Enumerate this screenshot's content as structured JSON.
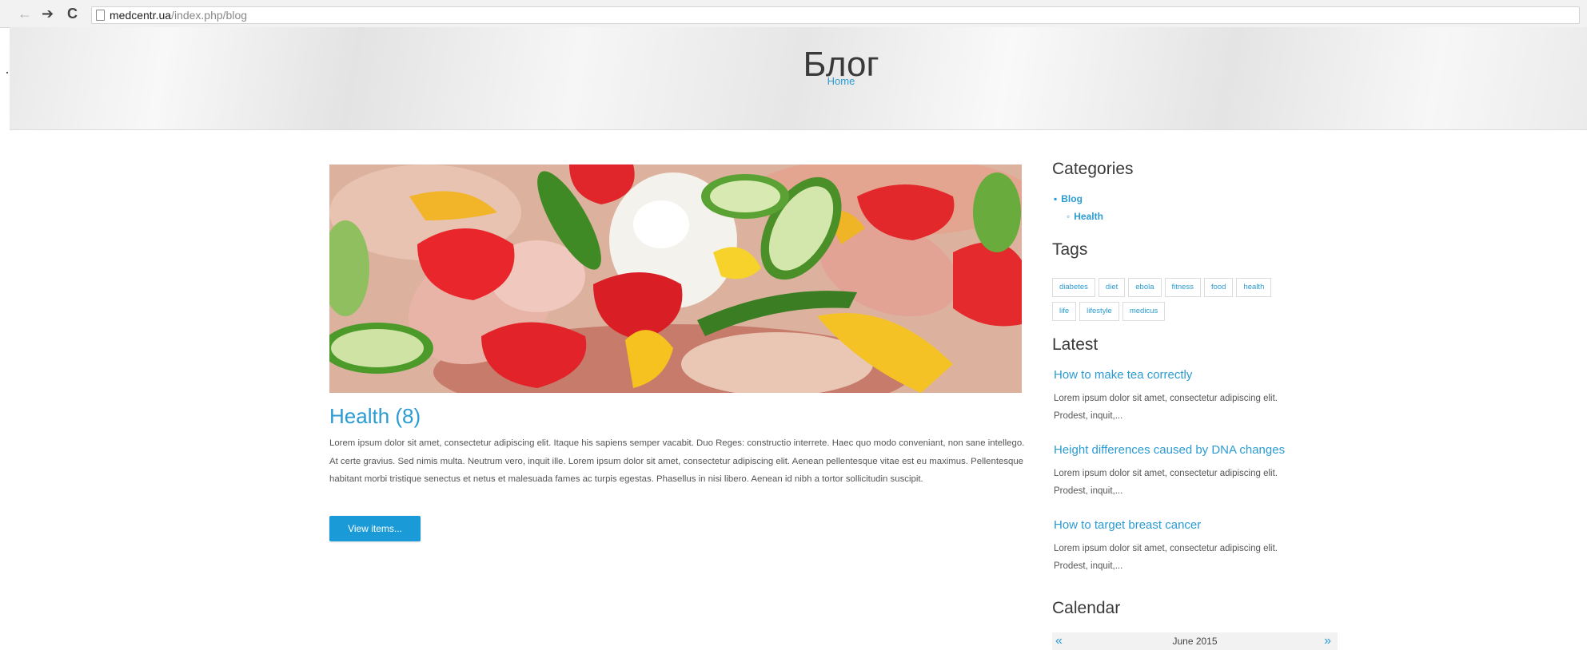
{
  "browser": {
    "url_host": "medcentr.ua",
    "url_path": "/index.php/blog",
    "back_glyph": "←",
    "forward_glyph": "➔",
    "reload_glyph": "C"
  },
  "header": {
    "title": "Блог",
    "breadcrumb": "Home"
  },
  "post": {
    "title": "Health (8)",
    "text": "Lorem ipsum dolor sit amet, consectetur adipiscing elit. Itaque his sapiens semper vacabit. Duo Reges: constructio interrete. Haec quo modo conveniant, non sane intellego. At certe gravius. Sed nimis multa. Neutrum vero, inquit ille. Lorem ipsum dolor sit amet, consectetur adipiscing elit. Aenean pellentesque vitae est eu maximus. Pellentesque habitant morbi tristique senectus et netus et malesuada fames ac turpis egestas. Phasellus in nisi libero. Aenean id nibh a tortor sollicitudin suscipit.",
    "button_label": "View items..."
  },
  "sidebar": {
    "categories_heading": "Categories",
    "categories": [
      {
        "label": "Blog",
        "bullet": "▪"
      },
      {
        "label": "Health",
        "bullet": "◦"
      }
    ],
    "tags_heading": "Tags",
    "tags": [
      "diabetes",
      "diet",
      "ebola",
      "fitness",
      "food",
      "health",
      "life",
      "lifestyle",
      "medicus"
    ],
    "latest_heading": "Latest",
    "latest": [
      {
        "title": "How to make tea correctly",
        "excerpt": "Lorem ipsum dolor sit amet, consectetur adipiscing elit. Prodest, inquit,..."
      },
      {
        "title": "Height differences caused by DNA changes",
        "excerpt": "Lorem ipsum dolor sit amet, consectetur adipiscing elit. Prodest, inquit,..."
      },
      {
        "title": "How to target breast cancer",
        "excerpt": "Lorem ipsum dolor sit amet, consectetur adipiscing elit. Prodest, inquit,..."
      }
    ],
    "calendar_heading": "Calendar",
    "calendar": {
      "month": "June 2015",
      "prev": "«",
      "next": "»"
    }
  },
  "colors": {
    "link": "#2b9bd3",
    "button": "#1a9ad6",
    "heading": "#3a3a3a",
    "text": "#555555"
  },
  "icons": {
    "page": "page-icon",
    "back": "arrow-left-icon",
    "forward": "arrow-right-icon",
    "reload": "reload-icon"
  }
}
